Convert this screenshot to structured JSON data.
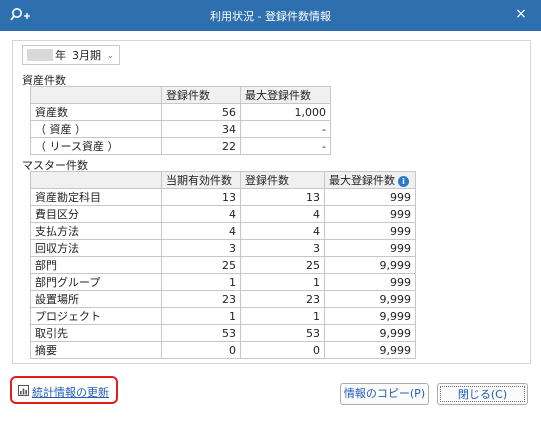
{
  "window": {
    "title": "利用状況 - 登録件数情報",
    "close_glyph": "×"
  },
  "period": {
    "year_suffix": "年",
    "month": "3月期",
    "dropdown_glyph": "⌄"
  },
  "registrations": {
    "title": "資産件数",
    "headers": [
      "",
      "登録件数",
      "最大登録件数"
    ],
    "rows": [
      {
        "label": "資産数",
        "count": "56",
        "max": "1,000"
      },
      {
        "label": "（ 資産 ）",
        "count": "34",
        "max": "-"
      },
      {
        "label": "（ リース資産 ）",
        "count": "22",
        "max": "-"
      }
    ]
  },
  "master": {
    "title": "マスター件数",
    "headers": [
      "",
      "当期有効件数",
      "登録件数",
      "最大登録件数"
    ],
    "info_glyph": "i",
    "rows": [
      {
        "label": "資産勘定科目",
        "active": "13",
        "count": "13",
        "max": "999"
      },
      {
        "label": "費目区分",
        "active": "4",
        "count": "4",
        "max": "999"
      },
      {
        "label": "支払方法",
        "active": "4",
        "count": "4",
        "max": "999"
      },
      {
        "label": "回収方法",
        "active": "3",
        "count": "3",
        "max": "999"
      },
      {
        "label": "部門",
        "active": "25",
        "count": "25",
        "max": "9,999"
      },
      {
        "label": "部門グループ",
        "active": "1",
        "count": "1",
        "max": "999"
      },
      {
        "label": "設置場所",
        "active": "23",
        "count": "23",
        "max": "9,999"
      },
      {
        "label": "プロジェクト",
        "active": "1",
        "count": "1",
        "max": "9,999"
      },
      {
        "label": "取引先",
        "active": "53",
        "count": "53",
        "max": "9,999"
      },
      {
        "label": "摘要",
        "active": "0",
        "count": "0",
        "max": "9,999"
      }
    ]
  },
  "footer": {
    "stats_link": "統計情報の更新",
    "copy_button": "情報のコピー(P)",
    "close_button": "閉じる(C)"
  },
  "colors": {
    "titlebar": "#2e6fb0",
    "highlight": "#e0201d",
    "link": "#1f5cb4"
  },
  "icons": {
    "app": "search-plus-icon",
    "close": "close-icon",
    "info": "info-icon",
    "stats": "chart-icon"
  }
}
